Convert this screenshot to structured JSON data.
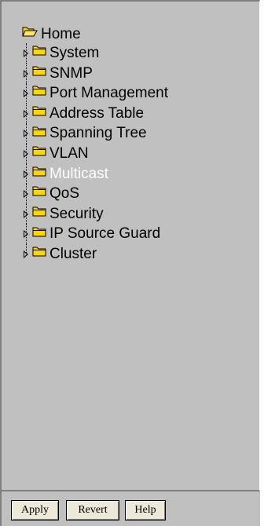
{
  "tree": {
    "root": {
      "label": "Home",
      "icon": "open-folder-icon"
    },
    "items": [
      {
        "label": "System",
        "icon": "folder-icon",
        "active": false
      },
      {
        "label": "SNMP",
        "icon": "folder-icon",
        "active": false
      },
      {
        "label": "Port Management",
        "icon": "folder-icon",
        "active": false
      },
      {
        "label": "Address Table",
        "icon": "folder-icon",
        "active": false
      },
      {
        "label": "Spanning Tree",
        "icon": "folder-icon",
        "active": false
      },
      {
        "label": "VLAN",
        "icon": "folder-icon",
        "active": false
      },
      {
        "label": "Multicast",
        "icon": "folder-icon",
        "active": true
      },
      {
        "label": "QoS",
        "icon": "folder-icon",
        "active": false
      },
      {
        "label": "Security",
        "icon": "folder-icon",
        "active": false
      },
      {
        "label": "IP Source Guard",
        "icon": "folder-icon",
        "active": false
      },
      {
        "label": "Cluster",
        "icon": "folder-icon",
        "active": false
      }
    ]
  },
  "buttons": {
    "apply": "Apply",
    "revert": "Revert",
    "help": "Help"
  },
  "colors": {
    "pane_background": "#c0c0c0",
    "folder_fill": "#ffd700",
    "folder_outline": "#000000",
    "active_text": "#ffffff",
    "text": "#000000"
  }
}
